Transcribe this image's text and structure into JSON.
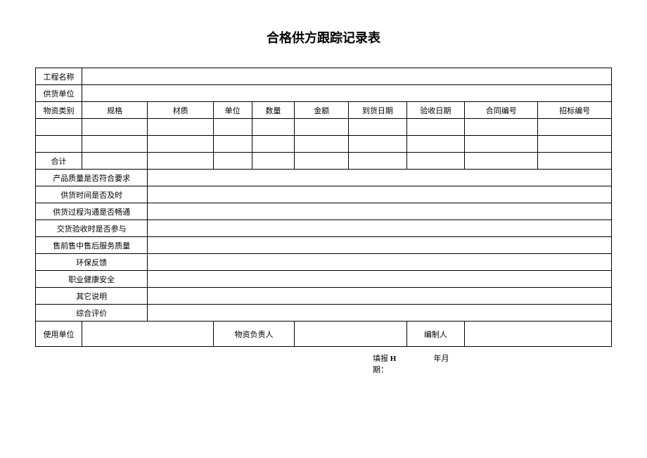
{
  "title": "合格供方跟踪记录表",
  "rows": {
    "project_name_label": "工程名称",
    "supplier_label": "供货单位",
    "category_label": "物资类别",
    "spec_label": "规格",
    "material_label": "材质",
    "unit_label": "单位",
    "qty_label": "数量",
    "amount_label": "金额",
    "arrival_date_label": "到货日期",
    "accept_date_label": "验收日期",
    "contract_no_label": "合同编号",
    "bid_no_label": "招标编号",
    "total_label": "合计",
    "q1": "产品质量是否符合要求",
    "q2": "供货时间是否及时",
    "q3": "供货过程沟通是否畅通",
    "q4": "交货验收时是否参与",
    "q5": "售前售中售后服务质量",
    "q6": "环保反馈",
    "q7": "职业健康安全",
    "q8": "其它说明",
    "q9": "综合评价",
    "use_unit_label": "使用单位",
    "material_person_label": "物资负责人",
    "preparer_label": "编制人"
  },
  "footer": {
    "fill_label_1": "填报",
    "fill_label_2": "期：",
    "h": "H",
    "ym": "年月"
  }
}
